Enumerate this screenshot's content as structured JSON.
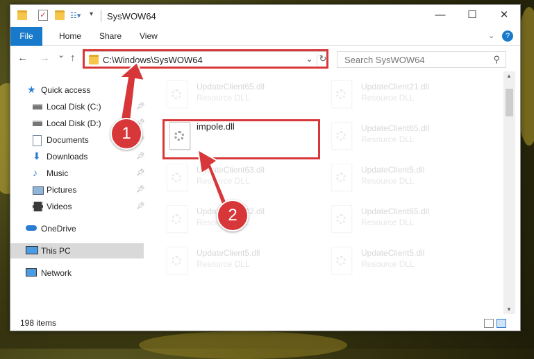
{
  "window": {
    "title": "SysWOW64",
    "minimize": "—",
    "maximize": "☐",
    "close": "✕"
  },
  "ribbon": {
    "tabs": [
      "File",
      "Home",
      "Share",
      "View"
    ]
  },
  "nav": {
    "back": "←",
    "forward": "→",
    "recent": "⌄",
    "up": "↑"
  },
  "address": {
    "path": "C:\\Windows\\SysWOW64"
  },
  "search": {
    "placeholder": "Search SysWOW64"
  },
  "sidebar": {
    "items": [
      {
        "label": "Quick access",
        "icon": "star-icon",
        "pinned": false
      },
      {
        "label": "Local Disk (C:)",
        "icon": "drive-icon",
        "pinned": true
      },
      {
        "label": "Local Disk (D:)",
        "icon": "drive-icon",
        "pinned": true
      },
      {
        "label": "Documents",
        "icon": "documents-icon",
        "pinned": true
      },
      {
        "label": "Downloads",
        "icon": "download-icon",
        "pinned": true
      },
      {
        "label": "Music",
        "icon": "music-icon",
        "pinned": true
      },
      {
        "label": "Pictures",
        "icon": "pictures-icon",
        "pinned": true
      },
      {
        "label": "Videos",
        "icon": "videos-icon",
        "pinned": true
      },
      {
        "label": "OneDrive",
        "icon": "cloud-icon",
        "pinned": false
      },
      {
        "label": "This PC",
        "icon": "computer-icon",
        "pinned": false
      },
      {
        "label": "Network",
        "icon": "network-icon",
        "pinned": false
      }
    ]
  },
  "files": [
    {
      "name": "UpdateClient65.dll",
      "type": "Resource DLL",
      "faded": true
    },
    {
      "name": "UpdateClient21.dll",
      "type": "Resource DLL",
      "faded": true
    },
    {
      "name": "impole.dll",
      "type": "",
      "faded": false
    },
    {
      "name": "UpdateClient65.dll",
      "type": "Resource DLL",
      "faded": true
    },
    {
      "name": "UpdateClient63.dll",
      "type": "Resource DLL",
      "faded": true
    },
    {
      "name": "UpdateClient5.dll",
      "type": "Resource DLL",
      "faded": true
    },
    {
      "name": "UpdateClient42.dll",
      "type": "Resource DLL",
      "faded": true
    },
    {
      "name": "UpdateClient65.dll",
      "type": "Resource DLL",
      "faded": true
    },
    {
      "name": "UpdateClient5.dll",
      "type": "Resource DLL",
      "faded": true
    },
    {
      "name": "UpdateClient5.dll",
      "type": "Resource DLL",
      "faded": true
    }
  ],
  "status": {
    "item_count": "198 items"
  },
  "annotations": {
    "step1": "1",
    "step2": "2",
    "color": "#d8373a"
  }
}
